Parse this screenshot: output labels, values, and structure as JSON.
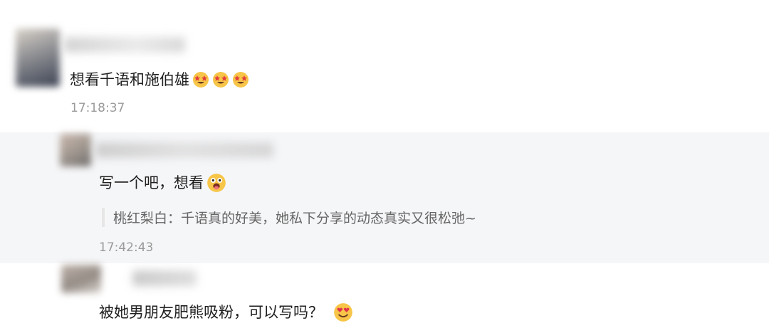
{
  "comments": [
    {
      "text": "想看千语和施伯雄",
      "emojis": [
        "star-struck-emoji",
        "star-struck-emoji",
        "star-struck-emoji"
      ],
      "time": "17:18:37"
    },
    {
      "text": "写一个吧，想看",
      "emojis": [
        "shocked-tongue-emoji"
      ],
      "quote": "桃红梨白：千语真的好美，她私下分享的动态真实又很松弛~",
      "time": "17:42:43"
    },
    {
      "text": "被她男朋友肥熊吸粉，可以写吗？",
      "emojis": [
        "heart-eyes-emoji"
      ]
    }
  ],
  "colors": {
    "reply_background": "#f5f6f8",
    "timestamp": "#9a9a9a",
    "emoji_face": "#f7c548"
  }
}
